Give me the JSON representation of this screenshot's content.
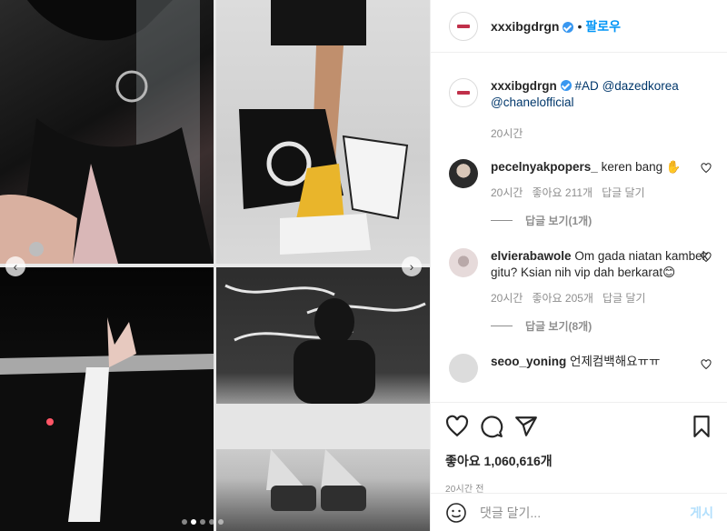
{
  "post": {
    "username": "xxxibgdrgn",
    "follow_label": "팔로우",
    "separator": "•",
    "caption_hashtag": "#AD",
    "caption_mention1": "@dazedkorea",
    "caption_mention2": "@chanelofficial",
    "caption_time": "20시간",
    "likes_label": "좋아요 1,060,616개",
    "time_ago": "20시간 전"
  },
  "comments": [
    {
      "username": "pecelnyakpopers_",
      "text": "keren bang ✋",
      "time": "20시간",
      "likes": "좋아요 211개",
      "reply": "답글 달기",
      "view_replies": "답글 보기(1개)"
    },
    {
      "username": "elvierabawole",
      "text": "Om gada niatan kambek gitu? Ksian nih vip dah berkarat😊",
      "time": "20시간",
      "likes": "좋아요 205개",
      "reply": "답글 달기",
      "view_replies": "답글 보기(8개)"
    },
    {
      "username": "seoo_yoning",
      "text": "언제컴백해요ㅠㅠ"
    }
  ],
  "compose": {
    "placeholder": "댓글 달기...",
    "post_label": "게시"
  },
  "carousel": {
    "slide_count": 5,
    "active_slide": 2
  },
  "colors": {
    "link": "#00376b",
    "follow": "#0095f6",
    "verified": "#3897f0",
    "muted": "#8e8e8e"
  },
  "icons": [
    "heart-icon",
    "comment-icon",
    "share-icon",
    "save-icon",
    "emoji-icon",
    "verified-icon",
    "chevron-left-icon",
    "chevron-right-icon"
  ]
}
